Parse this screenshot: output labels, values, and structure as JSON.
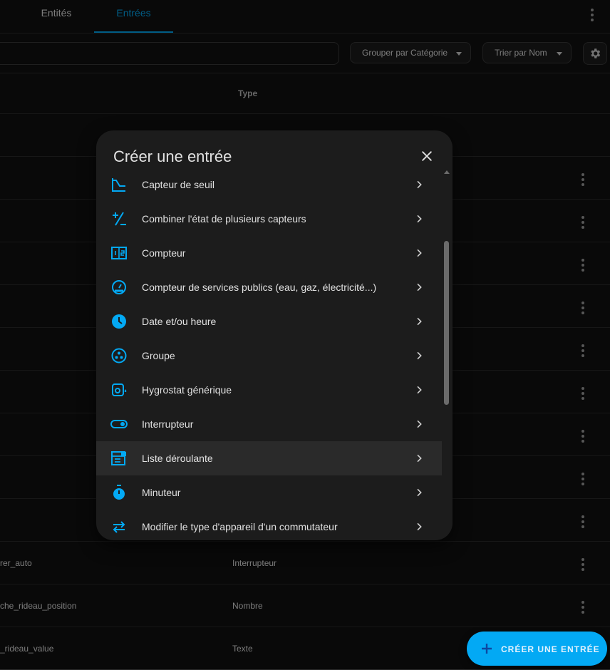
{
  "tabs": [
    {
      "label": "Entités",
      "active": false
    },
    {
      "label": "Entrées",
      "active": true
    }
  ],
  "toolbar": {
    "group_label": "Grouper par Catégorie",
    "sort_label": "Trier par Nom"
  },
  "table": {
    "type_header": "Type",
    "rows": [
      {
        "name": "rer_auto",
        "type": "Interrupteur"
      },
      {
        "name": "che_rideau_position",
        "type": "Nombre"
      },
      {
        "name": "_rideau_value",
        "type": "Texte"
      }
    ]
  },
  "dialog": {
    "title": "Créer une entrée",
    "items": [
      {
        "label": "Capteur de seuil",
        "icon": "threshold-icon"
      },
      {
        "label": "Combiner l'état de plusieurs capteurs",
        "icon": "plus-minus-icon"
      },
      {
        "label": "Compteur",
        "icon": "counter-icon"
      },
      {
        "label": "Compteur de services publics (eau, gaz, électricité...)",
        "icon": "gauge-icon"
      },
      {
        "label": "Date et/ou heure",
        "icon": "clock-icon"
      },
      {
        "label": "Groupe",
        "icon": "group-icon"
      },
      {
        "label": "Hygrostat générique",
        "icon": "hygrostat-icon"
      },
      {
        "label": "Interrupteur",
        "icon": "toggle-icon"
      },
      {
        "label": "Liste déroulante",
        "icon": "dropdown-list-icon"
      },
      {
        "label": "Minuteur",
        "icon": "timer-icon"
      },
      {
        "label": "Modifier le type d'appareil d'un commutateur",
        "icon": "swap-icon"
      }
    ]
  },
  "fab": {
    "label": "CRÉER UNE ENTRÉE"
  },
  "colors": {
    "accent": "#03a9f4",
    "background": "#111111",
    "surface": "#1c1c1c"
  }
}
